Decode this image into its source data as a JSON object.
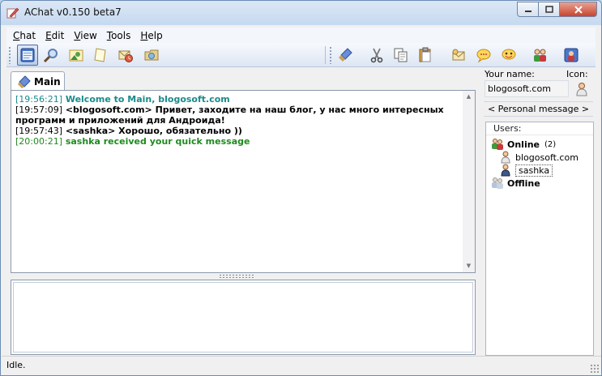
{
  "window": {
    "title": "AChat v0.150 beta7"
  },
  "menu": {
    "items": [
      {
        "first": "C",
        "rest": "hat"
      },
      {
        "first": "E",
        "rest": "dit"
      },
      {
        "first": "V",
        "rest": "iew"
      },
      {
        "first": "T",
        "rest": "ools"
      },
      {
        "first": "H",
        "rest": "elp"
      }
    ]
  },
  "toolbar": {
    "icons": [
      "chat-window-icon",
      "search-icon",
      "image-icon",
      "note-icon",
      "mail-clock-icon",
      "folder-icon",
      "clear-brush-icon",
      "cut-icon",
      "copy-icon",
      "paste-icon",
      "envelope-icon",
      "speech-bubble-icon",
      "smiley-icon",
      "users-icon",
      "settings-user-icon"
    ]
  },
  "tabs": [
    {
      "label": "Main"
    }
  ],
  "chat": {
    "messages": [
      {
        "time": "[19:56:21]",
        "text": " Welcome to Main, blogosoft.com",
        "color": "#1a8a8a"
      },
      {
        "time": "[19:57:09]",
        "text": " <blogosoft.com> Привет, заходите на наш блог, у нас много интересных программ и приложений для Андроида!",
        "color": "#000000"
      },
      {
        "time": "[19:57:43]",
        "text": " <sashka> Хорошо, обязательно ))",
        "color": "#000000"
      },
      {
        "time": "[20:00:21]",
        "text": " sashka received your quick message",
        "color": "#1f8a1f"
      }
    ],
    "input_value": ""
  },
  "sidebar": {
    "your_name_label": "Your name:",
    "icon_label": "Icon:",
    "name_value": "blogosoft.com",
    "personal_message": "< Personal message >",
    "users_header": "Users:",
    "online_label": "Online",
    "online_count": "(2)",
    "users_online": [
      "blogosoft.com",
      "sashka"
    ],
    "offline_label": "Offline"
  },
  "status": {
    "text": "Idle."
  },
  "colors": {
    "accent": "#1a8a8a",
    "system_green": "#1f8a1f",
    "frame": "#6b8cb5"
  }
}
